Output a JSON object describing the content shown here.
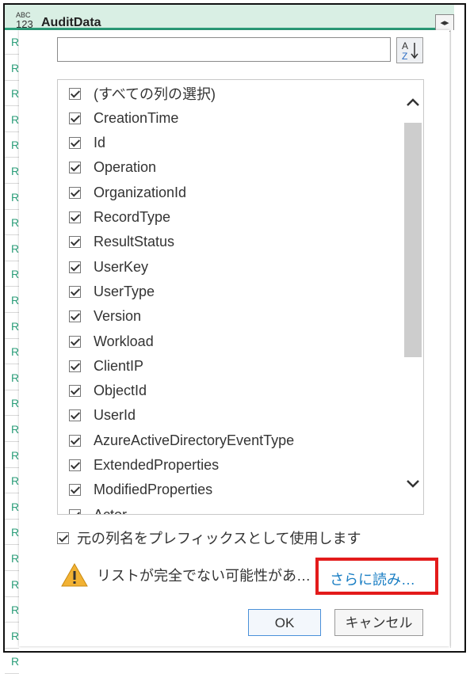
{
  "column": {
    "type_icon_top": "ABC",
    "type_icon_bottom": "123",
    "title": "AuditData",
    "row_prefix": "R"
  },
  "filter_dialog": {
    "search": {
      "value": "",
      "placeholder": ""
    },
    "columns": [
      {
        "label": "(すべての列の選択)",
        "checked": true
      },
      {
        "label": "CreationTime",
        "checked": true
      },
      {
        "label": "Id",
        "checked": true
      },
      {
        "label": "Operation",
        "checked": true
      },
      {
        "label": "OrganizationId",
        "checked": true
      },
      {
        "label": "RecordType",
        "checked": true
      },
      {
        "label": "ResultStatus",
        "checked": true
      },
      {
        "label": "UserKey",
        "checked": true
      },
      {
        "label": "UserType",
        "checked": true
      },
      {
        "label": "Version",
        "checked": true
      },
      {
        "label": "Workload",
        "checked": true
      },
      {
        "label": "ClientIP",
        "checked": true
      },
      {
        "label": "ObjectId",
        "checked": true
      },
      {
        "label": "UserId",
        "checked": true
      },
      {
        "label": "AzureActiveDirectoryEventType",
        "checked": true
      },
      {
        "label": "ExtendedProperties",
        "checked": true
      },
      {
        "label": "ModifiedProperties",
        "checked": true
      },
      {
        "label": "Actor",
        "checked": true
      }
    ],
    "prefix_option": {
      "label": "元の列名をプレフィックスとして使用します",
      "checked": true
    },
    "warning_text": "リストが完全でない可能性があ…",
    "load_more_label": "さらに読み…",
    "ok_label": "OK",
    "cancel_label": "キャンセル"
  },
  "colors": {
    "header_bg": "#d9efe4",
    "accent": "#2c9e7a",
    "link": "#1b7fc4",
    "highlight_border": "#e31b1b",
    "warning": "#f2b233"
  }
}
